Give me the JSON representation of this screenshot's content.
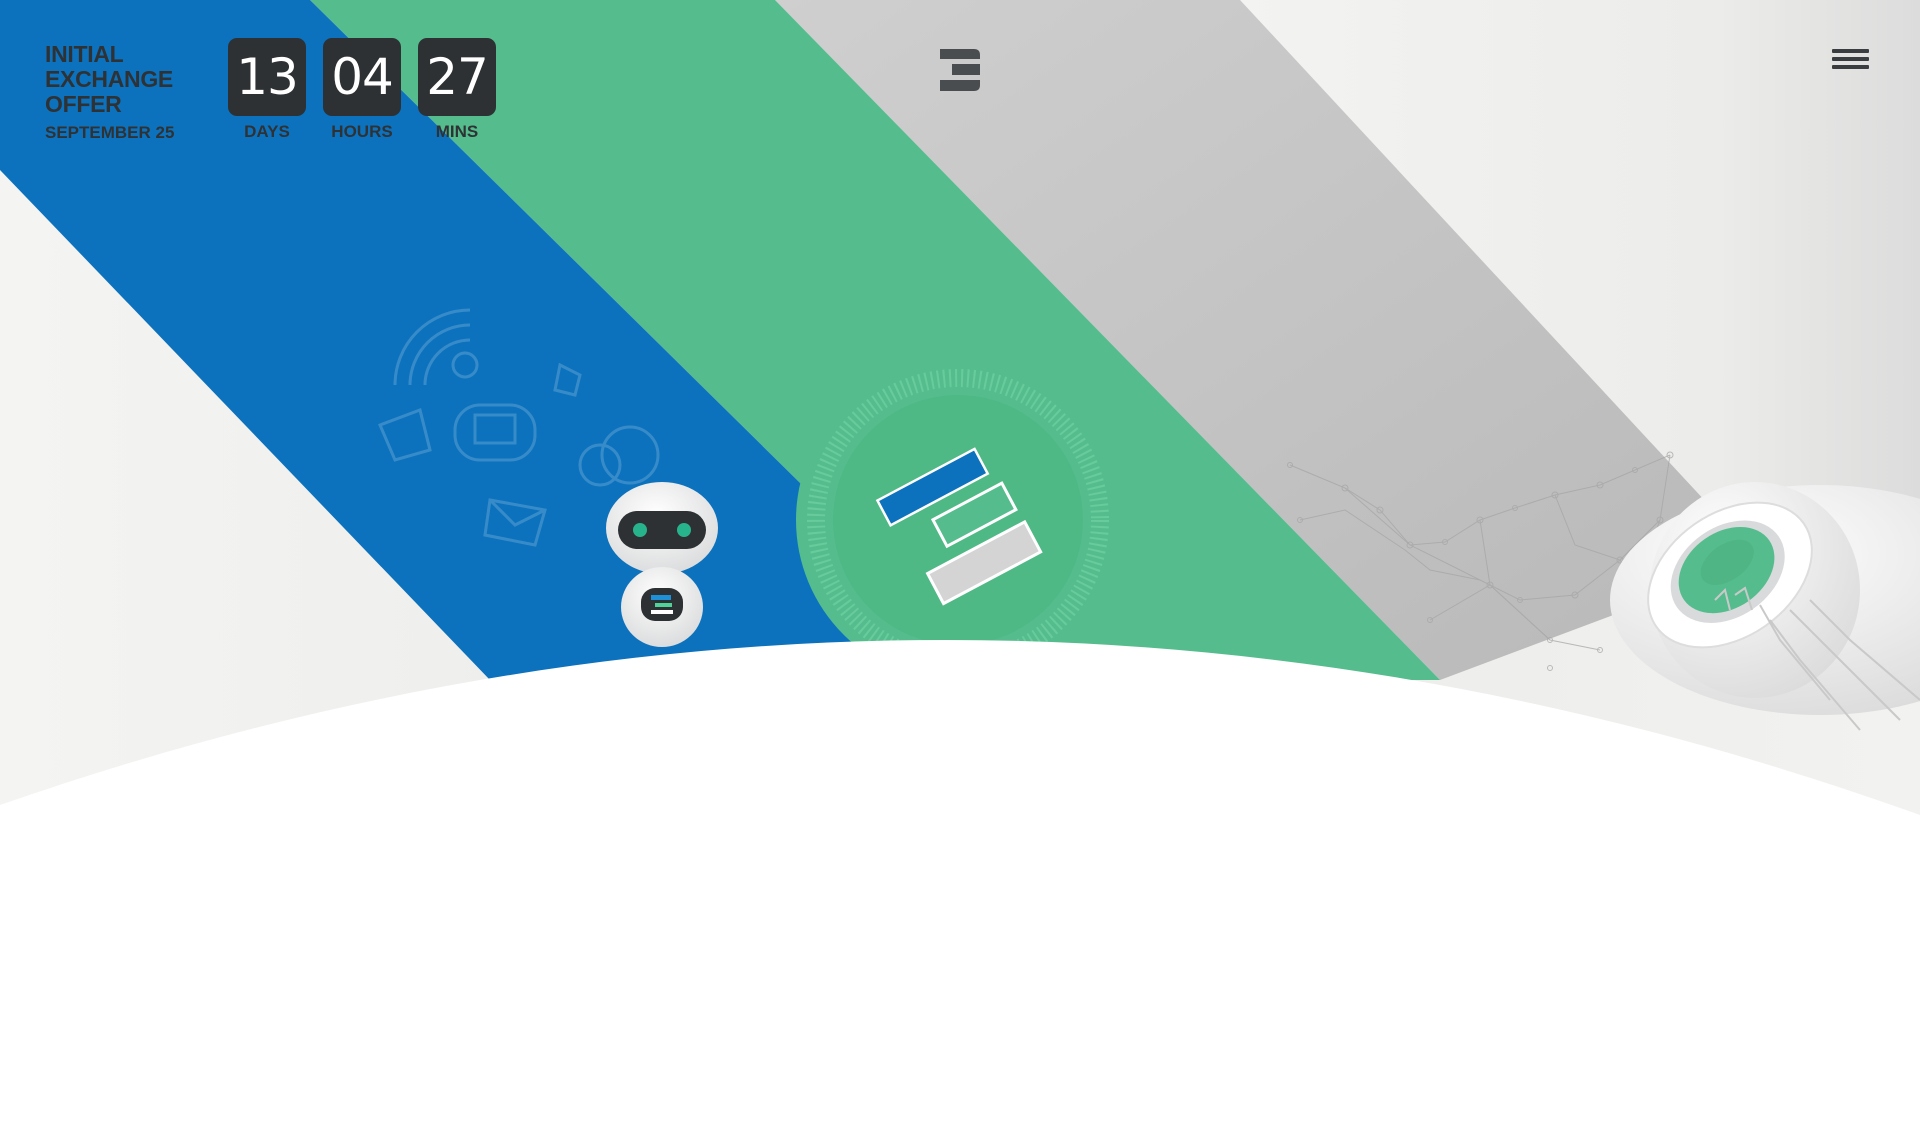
{
  "header": {
    "offer_title": "INITIAL EXCHANGE OFFER",
    "offer_date": "SEPTEMBER 25",
    "countdown": [
      {
        "value": "13",
        "label": "DAYS"
      },
      {
        "value": "04",
        "label": "HOURS"
      },
      {
        "value": "27",
        "label": "MINS"
      }
    ],
    "logo_icon": "brand-logo-icon",
    "menu_icon": "hamburger-menu-icon"
  },
  "hero": {
    "colors": {
      "blue": "#0c72bd",
      "green": "#55bd8d",
      "grey": "#c2c2c2",
      "light": "#eeeeec",
      "white": "#ffffff",
      "dark": "#2e3133"
    }
  }
}
